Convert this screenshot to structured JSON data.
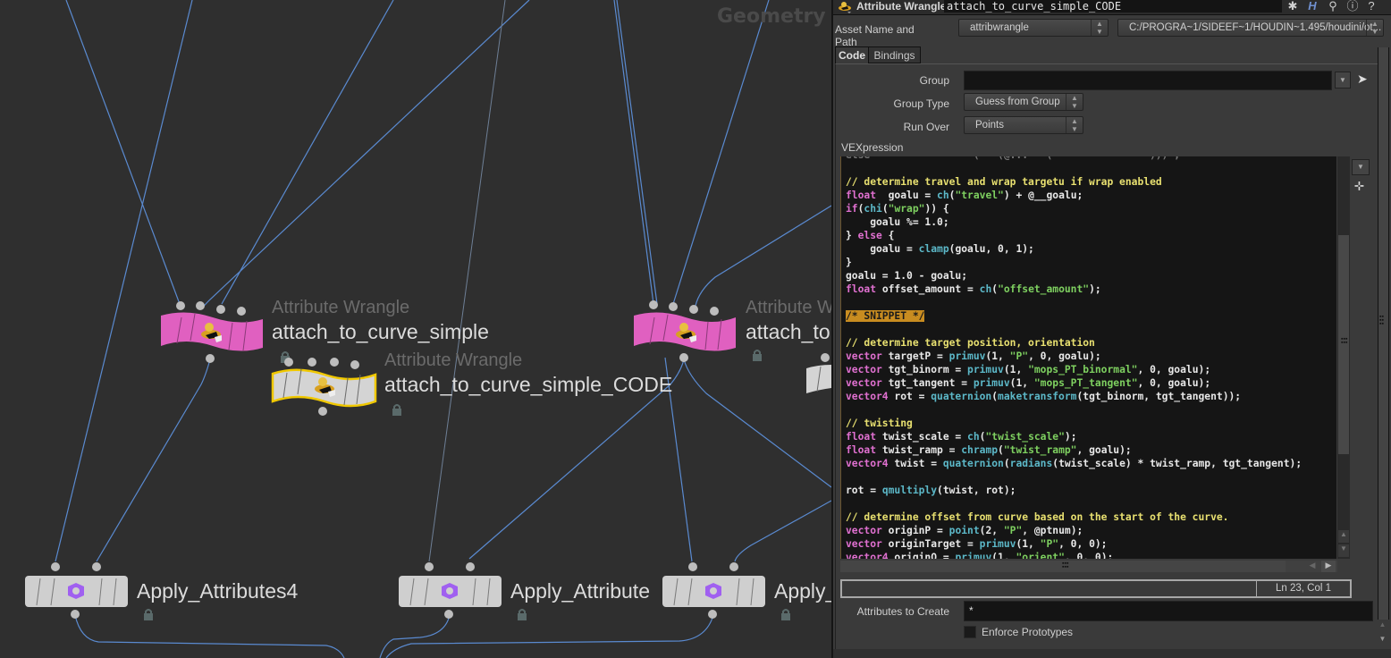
{
  "network": {
    "context_label": "Geometry",
    "nodes": [
      {
        "type": "Attribute Wrangle",
        "name": "attach_to_curve_simple",
        "color": "#e060c0"
      },
      {
        "type": "Attribute Wrangle",
        "name": "attach_to_curve_simple_CODE",
        "color": "#d4d4d4",
        "selected": true
      },
      {
        "type": "Attribute W",
        "name": "attach_to",
        "color": "#e060c0"
      },
      {
        "type": "",
        "name": "Apply_Attributes4",
        "color": "#cccccc"
      },
      {
        "type": "",
        "name": "Apply_Attribute",
        "color": "#cccccc"
      },
      {
        "type": "",
        "name": "Apply_",
        "color": "#cccccc"
      }
    ],
    "wire_color": "#5a8ad0",
    "selection_color": "#f0c800"
  },
  "panel": {
    "header": {
      "node_type": "Attribute Wrangle",
      "node_name": "attach_to_curve_simple_CODE",
      "icons": [
        "gear-icon",
        "houdini-h-icon",
        "search-icon",
        "info-icon",
        "help-icon"
      ]
    },
    "asset": {
      "label": "Asset Name and Path",
      "name": "attribwrangle",
      "path": "C:/PROGRA~1/SIDEEF~1/HOUDIN~1.495/houdini/ot..."
    },
    "tabs": [
      {
        "label": "Code",
        "active": true
      },
      {
        "label": "Bindings",
        "active": false
      }
    ],
    "group": {
      "label": "Group",
      "value": ""
    },
    "group_type": {
      "label": "Group Type",
      "value": "Guess from Group"
    },
    "run_over": {
      "label": "Run Over",
      "value": "Points"
    },
    "vex_label": "VEXpression",
    "code_lines": [
      {
        "t": "cut",
        "text": "else                 (   (@...   (                ))) ;                    "
      },
      {
        "t": "blank"
      },
      {
        "t": "cm",
        "text": "// determine travel and wrap targetu if wrap enabled"
      },
      {
        "t": "code",
        "parts": [
          [
            "kw",
            "float"
          ],
          [
            "",
            "  goalu = "
          ],
          [
            "fn",
            "ch"
          ],
          [
            "",
            "("
          ],
          [
            "str",
            "\"travel\""
          ],
          [
            "",
            ") + @__goalu;"
          ]
        ]
      },
      {
        "t": "code",
        "parts": [
          [
            "kw",
            "if"
          ],
          [
            "",
            "("
          ],
          [
            "fn",
            "chi"
          ],
          [
            "",
            "("
          ],
          [
            "str",
            "\"wrap\""
          ],
          [
            "",
            ")) {"
          ]
        ]
      },
      {
        "t": "code",
        "parts": [
          [
            "",
            "    goalu %= 1.0;"
          ]
        ]
      },
      {
        "t": "code",
        "parts": [
          [
            "",
            "} "
          ],
          [
            "kw",
            "else"
          ],
          [
            "",
            " {"
          ]
        ]
      },
      {
        "t": "code",
        "parts": [
          [
            "",
            "    goalu = "
          ],
          [
            "fn",
            "clamp"
          ],
          [
            "",
            "(goalu, 0, 1);"
          ]
        ]
      },
      {
        "t": "code",
        "parts": [
          [
            "",
            "}"
          ]
        ]
      },
      {
        "t": "code",
        "parts": [
          [
            "",
            "goalu = 1.0 - goalu;"
          ]
        ]
      },
      {
        "t": "code",
        "parts": [
          [
            "kw",
            "float"
          ],
          [
            "",
            " offset_amount = "
          ],
          [
            "fn",
            "ch"
          ],
          [
            "",
            "("
          ],
          [
            "str",
            "\"offset_amount\""
          ],
          [
            "",
            ");"
          ]
        ]
      },
      {
        "t": "blank"
      },
      {
        "t": "sn",
        "text": "/* SNIPPET */"
      },
      {
        "t": "blank"
      },
      {
        "t": "cm",
        "text": "// determine target position, orientation"
      },
      {
        "t": "code",
        "parts": [
          [
            "kw",
            "vector"
          ],
          [
            "",
            " targetP = "
          ],
          [
            "fn",
            "primuv"
          ],
          [
            "",
            "(1, "
          ],
          [
            "str",
            "\"P\""
          ],
          [
            "",
            ", 0, goalu);"
          ]
        ]
      },
      {
        "t": "code",
        "parts": [
          [
            "kw",
            "vector"
          ],
          [
            "",
            " tgt_binorm = "
          ],
          [
            "fn",
            "primuv"
          ],
          [
            "",
            "(1, "
          ],
          [
            "str",
            "\"mops_PT_binormal\""
          ],
          [
            "",
            ", 0, goalu);"
          ]
        ]
      },
      {
        "t": "code",
        "parts": [
          [
            "kw",
            "vector"
          ],
          [
            "",
            " tgt_tangent = "
          ],
          [
            "fn",
            "primuv"
          ],
          [
            "",
            "(1, "
          ],
          [
            "str",
            "\"mops_PT_tangent\""
          ],
          [
            "",
            ", 0, goalu);"
          ]
        ]
      },
      {
        "t": "code",
        "parts": [
          [
            "kw",
            "vector4"
          ],
          [
            "",
            " rot = "
          ],
          [
            "fn",
            "quaternion"
          ],
          [
            "",
            "("
          ],
          [
            "fn",
            "maketransform"
          ],
          [
            "",
            "(tgt_binorm, tgt_tangent));"
          ]
        ]
      },
      {
        "t": "blank"
      },
      {
        "t": "cm",
        "text": "// twisting"
      },
      {
        "t": "code",
        "parts": [
          [
            "kw",
            "float"
          ],
          [
            "",
            " twist_scale = "
          ],
          [
            "fn",
            "ch"
          ],
          [
            "",
            "("
          ],
          [
            "str",
            "\"twist_scale\""
          ],
          [
            "",
            ");"
          ]
        ]
      },
      {
        "t": "code",
        "parts": [
          [
            "kw",
            "float"
          ],
          [
            "",
            " twist_ramp = "
          ],
          [
            "fn",
            "chramp"
          ],
          [
            "",
            "("
          ],
          [
            "str",
            "\"twist_ramp\""
          ],
          [
            "",
            ", goalu);"
          ]
        ]
      },
      {
        "t": "code",
        "parts": [
          [
            "kw",
            "vector4"
          ],
          [
            "",
            " twist = "
          ],
          [
            "fn",
            "quaternion"
          ],
          [
            "",
            "("
          ],
          [
            "fn",
            "radians"
          ],
          [
            "",
            "(twist_scale) * twist_ramp, tgt_tangent);"
          ]
        ]
      },
      {
        "t": "blank"
      },
      {
        "t": "code",
        "parts": [
          [
            "",
            "rot = "
          ],
          [
            "fn",
            "qmultiply"
          ],
          [
            "",
            "(twist, rot);"
          ]
        ]
      },
      {
        "t": "blank"
      },
      {
        "t": "cm",
        "text": "// determine offset from curve based on the start of the curve."
      },
      {
        "t": "code",
        "parts": [
          [
            "kw",
            "vector"
          ],
          [
            "",
            " originP = "
          ],
          [
            "fn",
            "point"
          ],
          [
            "",
            "(2, "
          ],
          [
            "str",
            "\"P\""
          ],
          [
            "",
            ", @ptnum);"
          ]
        ]
      },
      {
        "t": "code",
        "parts": [
          [
            "kw",
            "vector"
          ],
          [
            "",
            " originTarget = "
          ],
          [
            "fn",
            "primuv"
          ],
          [
            "",
            "(1, "
          ],
          [
            "str",
            "\"P\""
          ],
          [
            "",
            ", 0, 0);"
          ]
        ]
      },
      {
        "t": "code",
        "parts": [
          [
            "kw",
            "vector4"
          ],
          [
            "",
            " originO = "
          ],
          [
            "fn",
            "primuv"
          ],
          [
            "",
            "(1, "
          ],
          [
            "str",
            "\"orient\""
          ],
          [
            "",
            ", 0, 0);"
          ]
        ]
      }
    ],
    "cursor_position": "Ln 23, Col 1",
    "attributes_to_create": {
      "label": "Attributes to Create",
      "value": "*"
    },
    "enforce_prototypes": {
      "label": "Enforce Prototypes",
      "checked": false
    }
  }
}
